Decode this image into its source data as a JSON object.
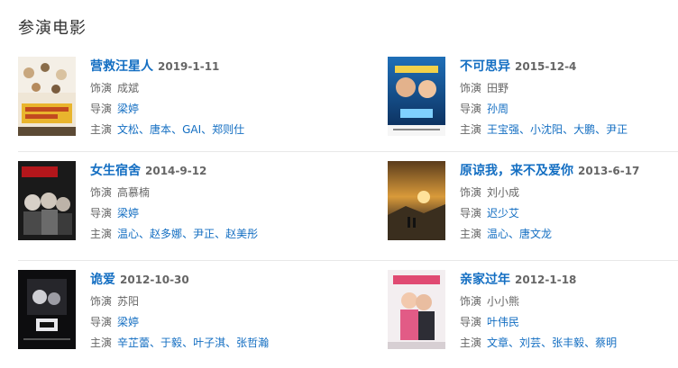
{
  "section": {
    "title": "参演电影"
  },
  "labels": {
    "role": "饰演",
    "director": "导演",
    "stars": "主演"
  },
  "separator": "、",
  "colors": {
    "link": "#136ec2",
    "text": "#666666",
    "divider": "#e8e8e8"
  },
  "movies": [
    {
      "title": "营救汪星人",
      "date": "2019-1-11",
      "role": "成斌",
      "director": "梁婷",
      "stars": [
        "文松",
        "唐本",
        "GAI",
        "郑则仕"
      ],
      "poster": "pet-rescue-poster"
    },
    {
      "title": "不可思异",
      "date": "2015-12-4",
      "role": "田野",
      "director": "孙周",
      "stars": [
        "王宝强",
        "小沈阳",
        "大鹏",
        "尹正"
      ],
      "poster": "comedy-poster"
    },
    {
      "title": "女生宿舍",
      "date": "2014-9-12",
      "role": "高慕楠",
      "director": "梁婷",
      "stars": [
        "温心",
        "赵多娜",
        "尹正",
        "赵美彤"
      ],
      "poster": "horror-dorm-poster"
    },
    {
      "title": "原谅我，来不及爱你",
      "date": "2013-6-17",
      "role": "刘小成",
      "director": "迟少艾",
      "stars": [
        "温心",
        "唐文龙"
      ],
      "poster": "sunset-poster"
    },
    {
      "title": "诡爱",
      "date": "2012-10-30",
      "role": "苏阳",
      "director": "梁婷",
      "stars": [
        "辛芷蕾",
        "于毅",
        "叶子淇",
        "张哲瀚"
      ],
      "poster": "dark-horror-poster"
    },
    {
      "title": "亲家过年",
      "date": "2012-1-18",
      "role": "小小熊",
      "director": "叶伟民",
      "stars": [
        "文章",
        "刘芸",
        "张丰毅",
        "蔡明"
      ],
      "poster": "couple-poster"
    }
  ]
}
